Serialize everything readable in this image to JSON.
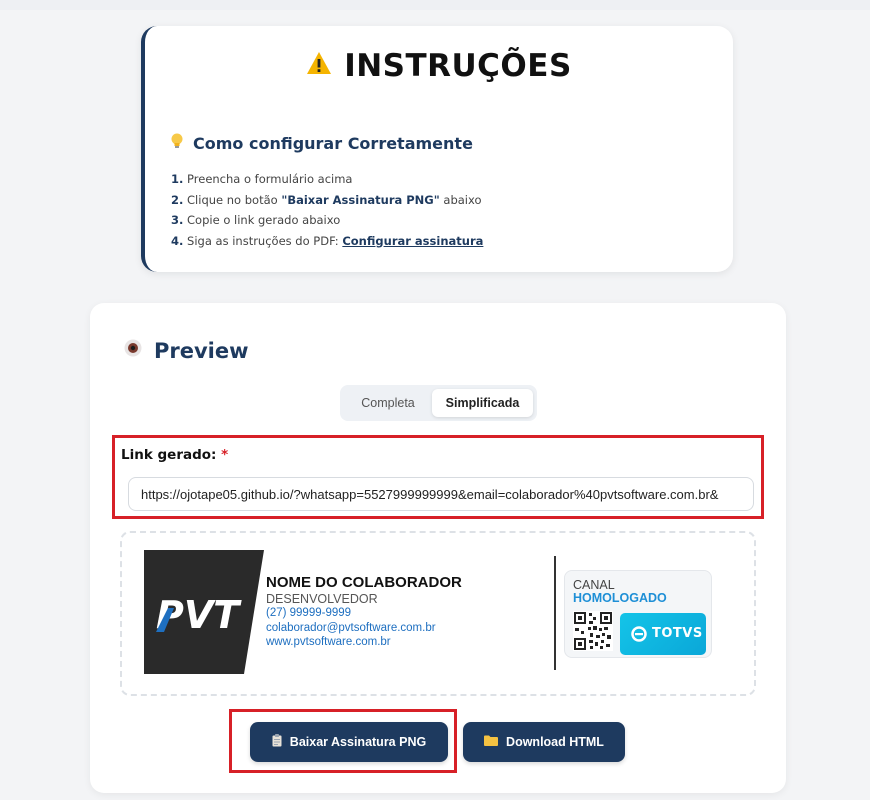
{
  "instructions": {
    "title": "INSTRUÇÕES",
    "subtitle": "Como configurar Corretamente",
    "step1_num": "1.",
    "step1_text": " Preencha o formulário acima",
    "step2_num": "2.",
    "step2_pre": " Clique no botão ",
    "step2_strong": "\"Baixar Assinatura PNG\"",
    "step2_post": " abaixo",
    "step3_num": "3.",
    "step3_text": " Copie o link gerado abaixo",
    "step4_num": "4.",
    "step4_pre": " Siga as instruções do PDF: ",
    "step4_link": "Configurar assinatura"
  },
  "preview": {
    "title": "Preview",
    "tabs": [
      "Completa",
      "Simplificada"
    ],
    "active_tab": "Simplificada",
    "link_label": "Link gerado:",
    "required_mark": "*",
    "link_value": "https://ojotape05.github.io/?whatsapp=5527999999999&email=colaborador%40pvtsoftware.com.br&"
  },
  "signature": {
    "logo_text": "PVT",
    "name": "NOME DO COLABORADOR",
    "role": "DESENVOLVEDOR",
    "phone": "(27) 99999-9999",
    "email": "colaborador@pvtsoftware.com.br",
    "website": "www.pvtsoftware.com.br",
    "canal_line1": "CANAL",
    "canal_line2": "HOMOLOGADO",
    "partner": "TOTVS"
  },
  "buttons": {
    "png_label": "Baixar Assinatura PNG",
    "html_label": "Download HTML"
  },
  "colors": {
    "accent": "#1e3a5f",
    "highlight": "#d72027",
    "link": "#1e6fc0",
    "totvs": "#14c4e8"
  },
  "icons": {
    "title": "warning-icon",
    "subtitle": "lightbulb-icon",
    "preview": "eye-icon",
    "png_button": "clipboard-icon",
    "html_button": "folder-icon"
  }
}
